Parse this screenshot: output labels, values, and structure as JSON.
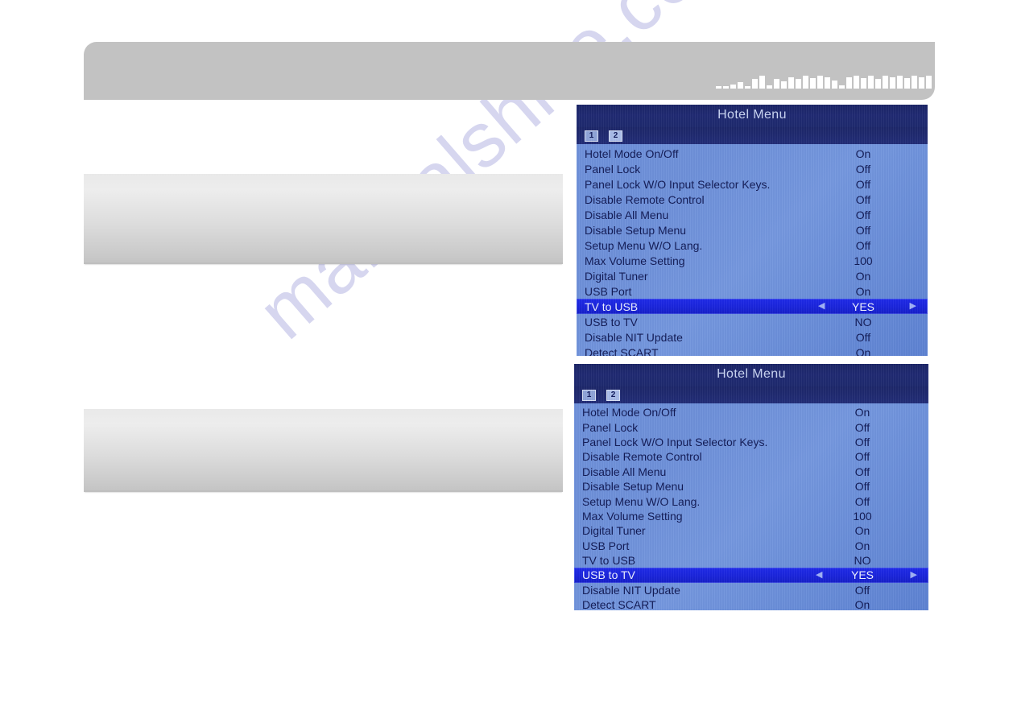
{
  "watermark": {
    "text": "manualshive.com"
  },
  "header": {
    "redacted_label": "redacted-text",
    "blocks": [
      3,
      0,
      3,
      0,
      0,
      5,
      8,
      3,
      12,
      16,
      4,
      12,
      9,
      14,
      12,
      16,
      13,
      16,
      14,
      10,
      4,
      14,
      16,
      13,
      16,
      12,
      16,
      14,
      16,
      13,
      16,
      14,
      16
    ]
  },
  "content_blocks": [
    {
      "name": "content-block-1"
    },
    {
      "name": "content-block-2"
    }
  ],
  "osd_panels": [
    {
      "title": "Hotel Menu",
      "tabs": [
        {
          "label": "1",
          "active": false
        },
        {
          "label": "2",
          "active": true
        }
      ],
      "rows": [
        {
          "label": "Hotel Mode On/Off",
          "value": "On",
          "selected": false
        },
        {
          "label": "Panel Lock",
          "value": "Off",
          "selected": false
        },
        {
          "label": "Panel Lock W/O Input Selector Keys.",
          "value": "Off",
          "selected": false
        },
        {
          "label": "Disable Remote Control",
          "value": "Off",
          "selected": false
        },
        {
          "label": "Disable All Menu",
          "value": "Off",
          "selected": false
        },
        {
          "label": "Disable Setup Menu",
          "value": "Off",
          "selected": false
        },
        {
          "label": "Setup Menu W/O Lang.",
          "value": "Off",
          "selected": false
        },
        {
          "label": "Max Volume Setting",
          "value": "100",
          "selected": false
        },
        {
          "label": "Digital Tuner",
          "value": "On",
          "selected": false
        },
        {
          "label": "USB Port",
          "value": "On",
          "selected": false
        },
        {
          "label": "TV to USB",
          "value": "YES",
          "selected": true
        },
        {
          "label": "USB to TV",
          "value": "NO",
          "selected": false
        },
        {
          "label": "Disable NIT Update",
          "value": "Off",
          "selected": false
        },
        {
          "label": "Detect SCART",
          "value": "On",
          "selected": false
        }
      ]
    },
    {
      "title": "Hotel Menu",
      "tabs": [
        {
          "label": "1",
          "active": false
        },
        {
          "label": "2",
          "active": true
        }
      ],
      "rows": [
        {
          "label": "Hotel Mode On/Off",
          "value": "On",
          "selected": false
        },
        {
          "label": "Panel Lock",
          "value": "Off",
          "selected": false
        },
        {
          "label": "Panel Lock W/O Input Selector Keys.",
          "value": "Off",
          "selected": false
        },
        {
          "label": "Disable Remote Control",
          "value": "Off",
          "selected": false
        },
        {
          "label": "Disable All Menu",
          "value": "Off",
          "selected": false
        },
        {
          "label": "Disable Setup Menu",
          "value": "Off",
          "selected": false
        },
        {
          "label": "Setup Menu W/O Lang.",
          "value": "Off",
          "selected": false
        },
        {
          "label": "Max Volume Setting",
          "value": "100",
          "selected": false
        },
        {
          "label": "Digital Tuner",
          "value": "On",
          "selected": false
        },
        {
          "label": "USB Port",
          "value": "On",
          "selected": false
        },
        {
          "label": "TV to USB",
          "value": "NO",
          "selected": false
        },
        {
          "label": "USB to TV",
          "value": "YES",
          "selected": true
        },
        {
          "label": "Disable NIT Update",
          "value": "Off",
          "selected": false
        },
        {
          "label": "Detect SCART",
          "value": "On",
          "selected": false
        }
      ]
    }
  ],
  "icons": {
    "arrow_left": "◀",
    "arrow_right": "▶"
  },
  "colors": {
    "header_bar": "#c2c2c2",
    "osd_titlebar": "#1e2a6e",
    "osd_body": "#6f91da",
    "osd_selected": "#1a24e0",
    "osd_text": "#111a55",
    "watermark": "#bdbee6"
  }
}
